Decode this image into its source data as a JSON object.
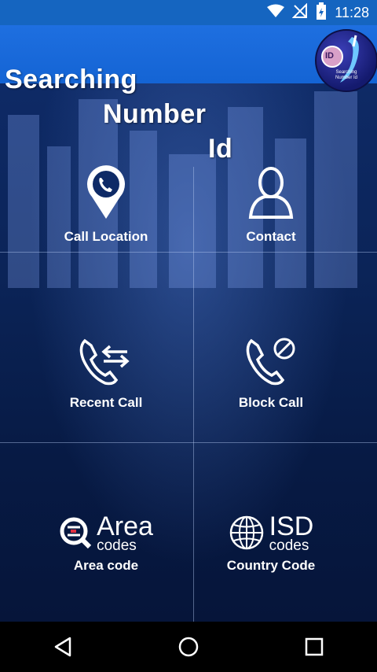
{
  "status_bar": {
    "time": "11:28"
  },
  "app": {
    "title_line1": "Searching",
    "title_line2": "Number",
    "title_line3": "Id",
    "logo_text": "Searching Number Id",
    "logo_letters": "ID"
  },
  "tiles": [
    {
      "label": "Call Location",
      "icon": "location-pin-phone-icon"
    },
    {
      "label": "Contact",
      "icon": "person-icon"
    },
    {
      "label": "Recent Call",
      "icon": "phone-arrows-icon"
    },
    {
      "label": "Block Call",
      "icon": "phone-block-icon"
    },
    {
      "label": "Area code",
      "icon": "area-codes-icon",
      "logo_big": "Area",
      "logo_small": "codes"
    },
    {
      "label": "Country Code",
      "icon": "isd-codes-icon",
      "logo_big": "ISD",
      "logo_small": "codes"
    }
  ],
  "colors": {
    "status_bar": "#1565c0",
    "app_bar": "#1e6fe0",
    "background": "#0b2458",
    "nav_bar": "#000000"
  },
  "nav": [
    "back-icon",
    "home-icon",
    "recents-icon"
  ]
}
